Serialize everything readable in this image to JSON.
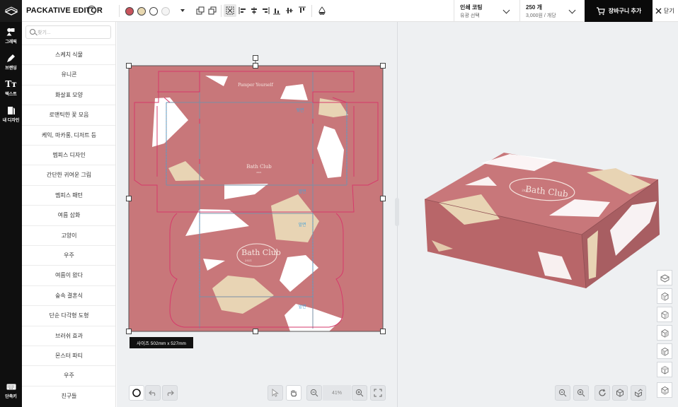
{
  "header": {
    "app_title": "PACKATIVE EDITOR",
    "help_symbol": "?",
    "finish": {
      "title": "인쇄 코팅",
      "subtitle": "유광 선택"
    },
    "quantity": {
      "title": "250 개",
      "subtitle": "3,000원 / 개당"
    },
    "cart_label": "장바구니 추가",
    "close_label": "닫기"
  },
  "swatches": [
    "#c8545c",
    "#e8d8b0",
    "#ffffff",
    "#f4f4f4"
  ],
  "rail": [
    {
      "label": "그래픽",
      "icon": "shapes-icon"
    },
    {
      "label": "브랜딩",
      "icon": "brand-icon"
    },
    {
      "label": "텍스트",
      "icon": "text-icon"
    },
    {
      "label": "내 디자인",
      "icon": "my-design-icon"
    }
  ],
  "rail_bottom": {
    "label": "단축키",
    "icon": "keyboard-icon"
  },
  "sidebar": {
    "search_placeholder": "찾기...",
    "categories": [
      "스케치 식물",
      "유니콘",
      "화살표 모양",
      "로맨틱한 꽃 모음",
      "케익, 마카롱, 디저트 등",
      "멤피스 디자인",
      "간단한 귀여운 그림",
      "멤피스 패턴",
      "여름 삽화",
      "고양이",
      "우주",
      "여름이 왔다",
      "숲속 결혼식",
      "단순 다각형 도형",
      "브러쉬 효과",
      "몬스터 파티",
      "우주",
      "친구들"
    ]
  },
  "design": {
    "tagline": "Pamper Yourself",
    "brand": "Bath Club",
    "brand_number": "2021",
    "panel_labels": {
      "top": "뒷면",
      "side_a": "옆면",
      "side_b": "앞면",
      "bottom": "앞면"
    },
    "colors": {
      "background": "#c8777a",
      "polygon_white": "#ffffff",
      "polygon_beige": "#e8d4b4",
      "cut_line": "#d63a6b",
      "fold_line": "#7a8fa6"
    }
  },
  "canvas": {
    "size_label": "사이즈 502mm x 527mm",
    "zoom_label": "41%"
  },
  "box3d": {
    "brand": "Bath Club",
    "brand_number": "2021"
  }
}
